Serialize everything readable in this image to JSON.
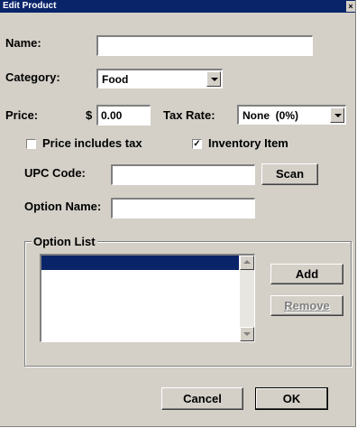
{
  "window": {
    "title": "Edit Product",
    "close_glyph": "×"
  },
  "form": {
    "name_label": "Name:",
    "name_value": "",
    "category_label": "Category:",
    "category_value": "Food",
    "price_label": "Price:",
    "price_currency": "$",
    "price_value": "0.00",
    "tax_rate_label": "Tax Rate:",
    "tax_rate_value": "None  (0%)",
    "price_includes_tax_label": "Price includes tax",
    "price_includes_tax_checked": false,
    "inventory_item_label": "Inventory Item",
    "inventory_item_checked": true,
    "check_mark": "✓",
    "upc_label": "UPC Code:",
    "upc_value": "",
    "scan_label": "Scan",
    "option_name_label": "Option Name:",
    "option_name_value": ""
  },
  "option_list": {
    "label": "Option List",
    "items": [],
    "add_label": "Add",
    "remove_label": "Remove"
  },
  "footer": {
    "cancel_label": "Cancel",
    "ok_label": "OK"
  }
}
